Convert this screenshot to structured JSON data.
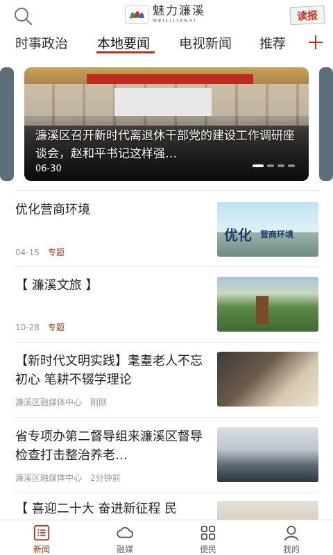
{
  "header": {
    "logo_cn": "魅力濂溪",
    "logo_en": "MEILILIANXI",
    "read_label": "读报"
  },
  "tabs": [
    {
      "label": "时事政治",
      "active": false
    },
    {
      "label": "本地要闻",
      "active": true
    },
    {
      "label": "电视新闻",
      "active": false
    },
    {
      "label": "推荐",
      "active": false
    }
  ],
  "carousel": {
    "title": "濂溪区召开新时代离退休干部党的建设工作调研座谈会，赵和平书记这样强…",
    "date": "06-30",
    "slide_count": 4,
    "active_slide": 1
  },
  "news": [
    {
      "title": "优化营商环境",
      "date": "04-15",
      "tag": "专题",
      "thumb_text_big": "优化",
      "thumb_text_small": "营商环境"
    },
    {
      "title": "【 濂溪文旅 】",
      "date": "10-28",
      "tag": "专题"
    },
    {
      "title": "【新时代文明实践】耄耋老人不忘初心 笔耕不辍学理论",
      "source": "濂溪区融媒体中心",
      "time": "刚刚"
    },
    {
      "title": "省专项办第二督导组来濂溪区督导检查打击整治养老…",
      "source": "濂溪区融媒体中心",
      "time": "2分钟前"
    },
    {
      "title": "【 喜迎二十大 奋进新征程 民"
    }
  ],
  "bottom_nav": [
    {
      "label": "新闻",
      "icon": "news-list-icon",
      "active": true
    },
    {
      "label": "融媒",
      "icon": "cloud-icon",
      "active": false
    },
    {
      "label": "便民",
      "icon": "grid-icon",
      "active": false
    },
    {
      "label": "我的",
      "icon": "user-icon",
      "active": false
    }
  ],
  "colors": {
    "accent": "#b5371f"
  }
}
